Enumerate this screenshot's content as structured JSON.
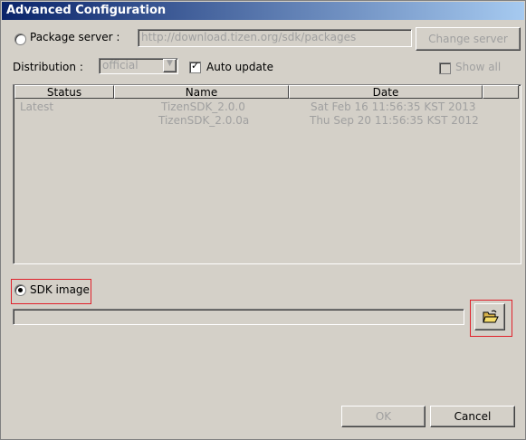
{
  "window": {
    "title": "Advanced Configuration"
  },
  "package_server": {
    "label": "Package server :",
    "url": "http://download.tizen.org/sdk/packages",
    "change_button": "Change server"
  },
  "distribution": {
    "label": "Distribution :",
    "value": "official",
    "auto_update_label": "Auto update",
    "auto_update_checked": true,
    "show_all_label": "Show all",
    "show_all_checked": false
  },
  "table": {
    "columns": [
      "Status",
      "Name",
      "Date"
    ],
    "rows": [
      {
        "status": "Latest",
        "name": "TizenSDK_2.0.0",
        "date": "Sat Feb 16 11:56:35 KST 2013"
      },
      {
        "status": "",
        "name": "TizenSDK_2.0.0a",
        "date": "Thu Sep 20 11:56:35 KST 2012"
      }
    ]
  },
  "sdk_image": {
    "label": "SDK image",
    "path": "",
    "browse_icon": "folder-open-icon"
  },
  "footer": {
    "ok": "OK",
    "cancel": "Cancel"
  },
  "colors": {
    "highlight": "#e0202a",
    "disabled": "#a0a0a0"
  }
}
